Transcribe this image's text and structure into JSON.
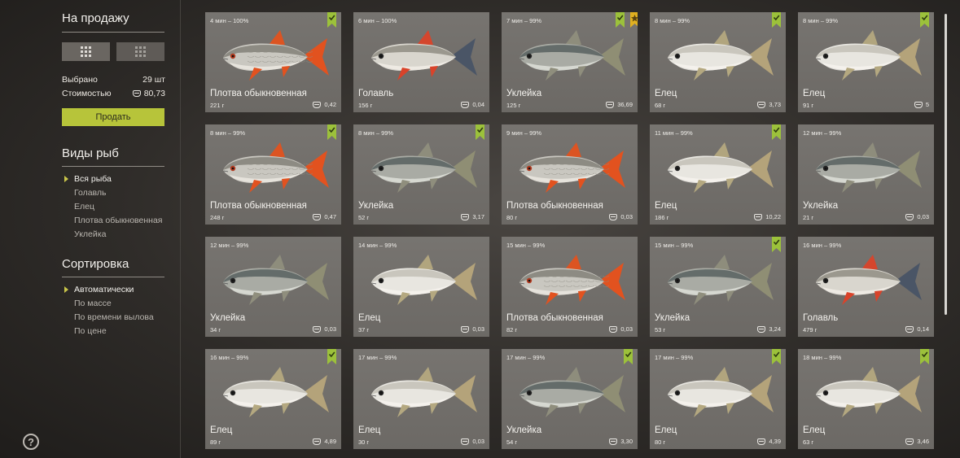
{
  "sidebar": {
    "title": "На продажу",
    "selected_label": "Выбрано",
    "selected_value": "29 шт",
    "cost_label": "Стоимостью",
    "cost_value": "80,73",
    "sell_button": "Продать",
    "species_title": "Виды рыб",
    "species": [
      {
        "label": "Вся рыба",
        "active": true
      },
      {
        "label": "Голавль",
        "active": false
      },
      {
        "label": "Елец",
        "active": false
      },
      {
        "label": "Плотва обыкновенная",
        "active": false
      },
      {
        "label": "Уклейка",
        "active": false
      }
    ],
    "sort_title": "Сортировка",
    "sort": [
      {
        "label": "Автоматически",
        "active": true
      },
      {
        "label": "По массе",
        "active": false
      },
      {
        "label": "По времени вылова",
        "active": false
      },
      {
        "label": "По цене",
        "active": false
      }
    ],
    "help": "?"
  },
  "colors": {
    "accent": "#b7c43a",
    "bookmark_green": "#9cc13b",
    "bookmark_star": "#e0b020"
  },
  "cards": [
    {
      "meta": "4 мин – 100%",
      "name": "Плотва обыкновенная",
      "weight": "221 г",
      "price": "0,42",
      "fish": "roach",
      "check": true,
      "star": false
    },
    {
      "meta": "6 мин – 100%",
      "name": "Голавль",
      "weight": "156 г",
      "price": "0,04",
      "fish": "chub",
      "check": false,
      "star": false
    },
    {
      "meta": "7 мин – 99%",
      "name": "Уклейка",
      "weight": "125 г",
      "price": "36,69",
      "fish": "bleak",
      "check": true,
      "star": true
    },
    {
      "meta": "8 мин – 99%",
      "name": "Елец",
      "weight": "68 г",
      "price": "3,73",
      "fish": "dace",
      "check": true,
      "star": false
    },
    {
      "meta": "8 мин – 99%",
      "name": "Елец",
      "weight": "91 г",
      "price": "5",
      "fish": "dace",
      "check": true,
      "star": false
    },
    {
      "meta": "8 мин – 99%",
      "name": "Плотва обыкновенная",
      "weight": "248 г",
      "price": "0,47",
      "fish": "roach",
      "check": true,
      "star": false
    },
    {
      "meta": "8 мин – 99%",
      "name": "Уклейка",
      "weight": "52 г",
      "price": "3,17",
      "fish": "bleak",
      "check": true,
      "star": false
    },
    {
      "meta": "9 мин – 99%",
      "name": "Плотва обыкновенная",
      "weight": "80 г",
      "price": "0,03",
      "fish": "roach",
      "check": false,
      "star": false
    },
    {
      "meta": "11 мин – 99%",
      "name": "Елец",
      "weight": "186 г",
      "price": "10,22",
      "fish": "dace",
      "check": true,
      "star": false
    },
    {
      "meta": "12 мин – 99%",
      "name": "Уклейка",
      "weight": "21 г",
      "price": "0,03",
      "fish": "bleak",
      "check": false,
      "star": false
    },
    {
      "meta": "12 мин – 99%",
      "name": "Уклейка",
      "weight": "34 г",
      "price": "0,03",
      "fish": "bleak",
      "check": false,
      "star": false
    },
    {
      "meta": "14 мин – 99%",
      "name": "Елец",
      "weight": "37 г",
      "price": "0,03",
      "fish": "dace",
      "check": false,
      "star": false
    },
    {
      "meta": "15 мин – 99%",
      "name": "Плотва обыкновенная",
      "weight": "82 г",
      "price": "0,03",
      "fish": "roach",
      "check": false,
      "star": false
    },
    {
      "meta": "15 мин – 99%",
      "name": "Уклейка",
      "weight": "53 г",
      "price": "3,24",
      "fish": "bleak",
      "check": true,
      "star": false
    },
    {
      "meta": "16 мин – 99%",
      "name": "Голавль",
      "weight": "479 г",
      "price": "0,14",
      "fish": "chub",
      "check": false,
      "star": false
    },
    {
      "meta": "16 мин – 99%",
      "name": "Елец",
      "weight": "89 г",
      "price": "4,89",
      "fish": "dace",
      "check": true,
      "star": false
    },
    {
      "meta": "17 мин – 99%",
      "name": "Елец",
      "weight": "30 г",
      "price": "0,03",
      "fish": "dace",
      "check": false,
      "star": false
    },
    {
      "meta": "17 мин – 99%",
      "name": "Уклейка",
      "weight": "54 г",
      "price": "3,30",
      "fish": "bleak",
      "check": true,
      "star": false
    },
    {
      "meta": "17 мин – 99%",
      "name": "Елец",
      "weight": "80 г",
      "price": "4,39",
      "fish": "dace",
      "check": true,
      "star": false
    },
    {
      "meta": "18 мин – 99%",
      "name": "Елец",
      "weight": "63 г",
      "price": "3,46",
      "fish": "dace",
      "check": true,
      "star": false
    }
  ]
}
